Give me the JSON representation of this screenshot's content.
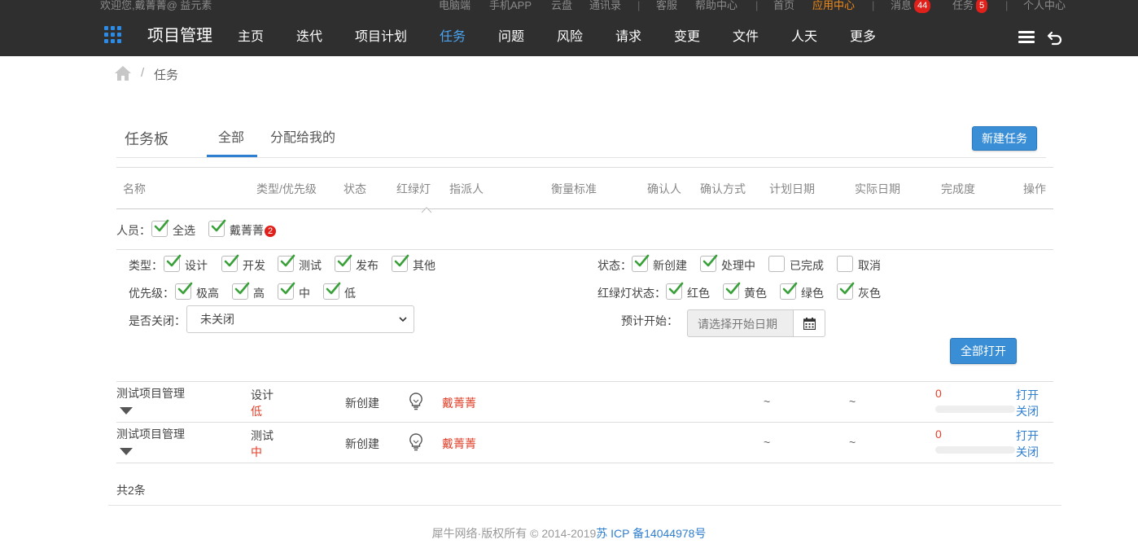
{
  "topbar": {
    "welcome": "欢迎您,戴菁菁@ 益元素",
    "links": [
      "电脑端",
      "手机APP",
      "云盘",
      "通讯录",
      "客服",
      "帮助中心",
      "首页",
      "应用中心"
    ],
    "messages_label": "消息",
    "messages_count": "44",
    "tasks_label": "任务",
    "tasks_count": "5",
    "personal_center": "个人中心"
  },
  "nav": {
    "brand": "项目管理",
    "items": [
      "主页",
      "迭代",
      "项目计划",
      "任务",
      "问题",
      "风险",
      "请求",
      "变更",
      "文件",
      "人天",
      "更多"
    ],
    "active_index": 3
  },
  "breadcrumb": {
    "separator": "/",
    "current": "任务"
  },
  "board": {
    "title": "任务板",
    "tabs": [
      "全部",
      "分配给我的"
    ],
    "active_tab": 0,
    "new_task_button": "新建任务"
  },
  "table": {
    "headers": [
      "名称",
      "类型/优先级",
      "状态",
      "红绿灯",
      "指派人",
      "衡量标准",
      "确认人",
      "确认方式",
      "计划日期",
      "实际日期",
      "完成度",
      "操作"
    ]
  },
  "filters": {
    "people_label": "人员：",
    "people": [
      {
        "label": "全选",
        "checked": true
      },
      {
        "label": "戴菁菁",
        "checked": true,
        "badge": "2"
      }
    ],
    "type_label": "类型：",
    "types": [
      {
        "label": "设计",
        "checked": true
      },
      {
        "label": "开发",
        "checked": true
      },
      {
        "label": "测试",
        "checked": true
      },
      {
        "label": "发布",
        "checked": true
      },
      {
        "label": "其他",
        "checked": true
      }
    ],
    "status_label": "状态：",
    "statuses": [
      {
        "label": "新创建",
        "checked": true
      },
      {
        "label": "处理中",
        "checked": true
      },
      {
        "label": "已完成",
        "checked": false
      },
      {
        "label": "取消",
        "checked": false
      }
    ],
    "priority_label": "优先级：",
    "priorities": [
      {
        "label": "极高",
        "checked": true
      },
      {
        "label": "高",
        "checked": true
      },
      {
        "label": "中",
        "checked": true
      },
      {
        "label": "低",
        "checked": true
      }
    ],
    "light_label": "红绿灯状态：",
    "lights": [
      {
        "label": "红色",
        "checked": true
      },
      {
        "label": "黄色",
        "checked": true
      },
      {
        "label": "绿色",
        "checked": true
      },
      {
        "label": "灰色",
        "checked": true
      }
    ],
    "closed_label": "是否关闭：",
    "closed_value": "未关闭",
    "planned_start_label": "预计开始：",
    "planned_start_placeholder": "请选择开始日期",
    "expand_all_button": "全部打开"
  },
  "rows": [
    {
      "name": "测试项目管理",
      "type": "设计",
      "priority": "低",
      "status": "新创建",
      "assignee": "戴菁菁",
      "plan_date": "~",
      "actual_date": "~",
      "progress": "0",
      "progress_fraction": 0,
      "actions": [
        "打开",
        "关闭"
      ]
    },
    {
      "name": "测试项目管理",
      "type": "测试",
      "priority": "中",
      "status": "新创建",
      "assignee": "戴菁菁",
      "plan_date": "~",
      "actual_date": "~",
      "progress": "0",
      "progress_fraction": 0,
      "actions": [
        "打开",
        "关闭"
      ]
    }
  ],
  "total": "共2条",
  "footer": {
    "copyright": "犀牛网络·版权所有 © 2014-2019",
    "icp": "苏 ICP 备14044978号"
  },
  "colors": {
    "topbar": "#2f2f2f",
    "accent": "#2f7fd0",
    "orange": "#f08a1a",
    "red": "#e0402a",
    "check": "#3aa03a"
  }
}
